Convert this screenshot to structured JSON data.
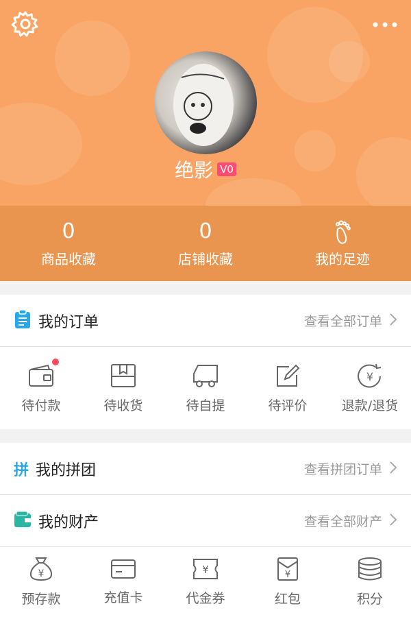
{
  "profile": {
    "username": "绝影",
    "level_badge": "V0"
  },
  "stats": [
    {
      "count": "0",
      "label": "商品收藏",
      "icon": "heart"
    },
    {
      "count": "0",
      "label": "店铺收藏",
      "icon": "store"
    },
    {
      "count": "",
      "label": "我的足迹",
      "icon": "footprint-icon"
    }
  ],
  "orders": {
    "title": "我的订单",
    "view_all": "查看全部订单",
    "items": [
      {
        "label": "待付款",
        "icon": "wallet-icon",
        "has_badge_dot": true
      },
      {
        "label": "待收货",
        "icon": "package-icon"
      },
      {
        "label": "待自提",
        "icon": "truck-icon"
      },
      {
        "label": "待评价",
        "icon": "pencil-edit-icon"
      },
      {
        "label": "退款/退货",
        "icon": "refund-icon"
      }
    ]
  },
  "group_buy": {
    "icon_char": "拼",
    "title": "我的拼团",
    "view_all": "查看拼团订单"
  },
  "assets": {
    "title": "我的财产",
    "view_all": "查看全部财产",
    "items": [
      {
        "label": "预存款",
        "icon": "money-bag-icon"
      },
      {
        "label": "充值卡",
        "icon": "card-icon"
      },
      {
        "label": "代金券",
        "icon": "voucher-icon"
      },
      {
        "label": "红包",
        "icon": "red-envelope-icon"
      },
      {
        "label": "积分",
        "icon": "coins-icon"
      }
    ]
  },
  "colors": {
    "header_bg": "#f9a464",
    "stats_band_bg": "#e9944f",
    "badge": "#ff4a74",
    "accent_blue": "#2aa7e8",
    "accent_teal": "#2ab5a5"
  }
}
